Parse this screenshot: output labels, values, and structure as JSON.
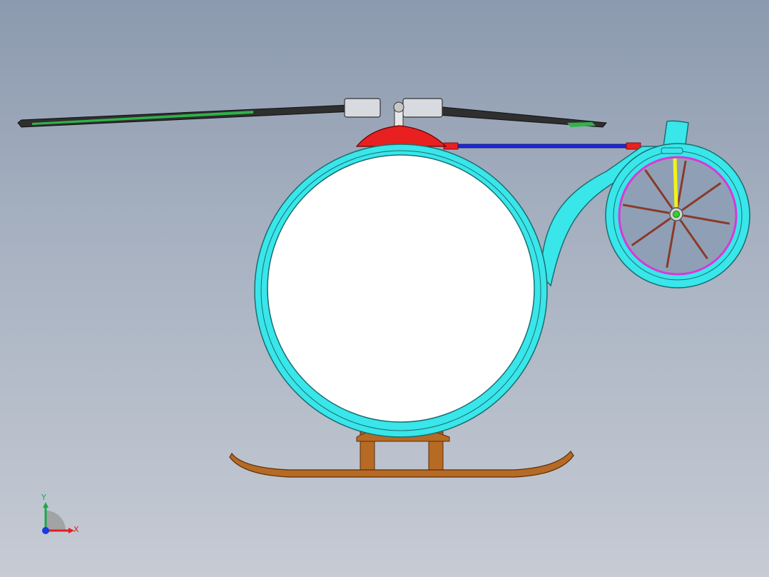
{
  "viewport": {
    "background_top": "#8c9aaf",
    "background_bottom": "#c6cbd4"
  },
  "model": {
    "colors": {
      "cabin_frame": "#39e6ea",
      "cabin_window": "#ffffff",
      "rotor_hub": "#e82020",
      "tail_boom_rod": "#1c2ad8",
      "skid": "#b66a24",
      "rotor_blade": "#2f2f2f",
      "blade_tip": "#2fb34a",
      "fan_ring": "#d838d8",
      "fan_spoke": "#8a3a2a",
      "fan_highlight": "#f2f21c",
      "fan_center": "#2fd42f"
    },
    "tail_fan_spoke_count": 8
  },
  "triad": {
    "y_label": "Y",
    "x_label": "X",
    "y_color": "#1ba84b",
    "x_color": "#e02020",
    "z_color": "#1a3ae0"
  }
}
